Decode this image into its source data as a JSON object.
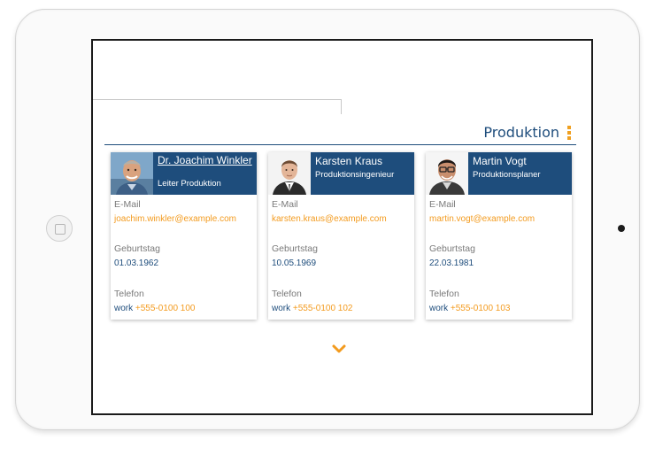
{
  "section": {
    "title": "Produktion"
  },
  "contacts": [
    {
      "name": "Dr. Joachim Winkler",
      "role": "Leiter Produktion",
      "email_label": "E-Mail",
      "email": "joachim.winkler@example.com",
      "birthday_label": "Geburtstag",
      "birthday": "01.03.1962",
      "phone_label": "Telefon",
      "phone_type": "work",
      "phone": "+555-0100 100"
    },
    {
      "name": "Karsten Kraus",
      "role": "Produktionsingenieur",
      "email_label": "E-Mail",
      "email": "karsten.kraus@example.com",
      "birthday_label": "Geburtstag",
      "birthday": "10.05.1969",
      "phone_label": "Telefon",
      "phone_type": "work",
      "phone": "+555-0100 102"
    },
    {
      "name": "Martin Vogt",
      "role": "Produktionsplaner",
      "email_label": "E-Mail",
      "email": "martin.vogt@example.com",
      "birthday_label": "Geburtstag",
      "birthday": "22.03.1981",
      "phone_label": "Telefon",
      "phone_type": "work",
      "phone": "+555-0100 103"
    }
  ],
  "icons": {
    "menu": "vertical-dots-icon",
    "expand": "chevron-down-icon"
  },
  "colors": {
    "primary": "#1e4d7c",
    "accent": "#f39b1f",
    "label": "#7a7a7a"
  }
}
